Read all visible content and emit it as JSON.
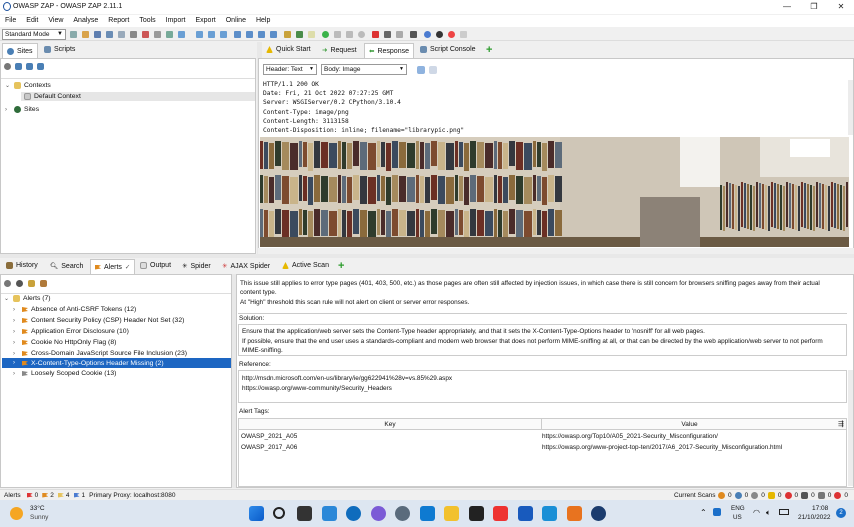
{
  "window": {
    "title": "OWASP ZAP - OWASP ZAP 2.11.1",
    "controls": [
      "—",
      "❐",
      "✕"
    ]
  },
  "menu": [
    "File",
    "Edit",
    "View",
    "Analyse",
    "Report",
    "Tools",
    "Import",
    "Export",
    "Online",
    "Help"
  ],
  "toolbar": {
    "mode": "Standard Mode"
  },
  "left_top": {
    "tabs": [
      "Sites",
      "Scripts"
    ],
    "tree": {
      "contexts": "Contexts",
      "default_context": "Default Context",
      "sites": "Sites"
    }
  },
  "right_top": {
    "tabs": [
      "Quick Start",
      "Request",
      "Response",
      "Script Console"
    ],
    "header_view": "Header: Text",
    "body_view": "Body: Image",
    "response_headers": [
      "HTTP/1.1 200 OK",
      "Date: Fri, 21 Oct 2022 07:27:25 GMT",
      "Server: WSGIServer/0.2 CPython/3.10.4",
      "Content-Type: image/png",
      "Content-Length: 3113158",
      "Content-Disposition: inline; filename=\"librarypic.png\""
    ]
  },
  "bottom": {
    "tabs": [
      "History",
      "Search",
      "Alerts",
      "Output",
      "Spider",
      "AJAX Spider",
      "Active Scan"
    ],
    "alerts_root": "Alerts (7)",
    "alerts": [
      "Absence of Anti-CSRF Tokens (12)",
      "Content Security Policy (CSP) Header Not Set (32)",
      "Application Error Disclosure (10)",
      "Cookie No HttpOnly Flag (8)",
      "Cross-Domain JavaScript Source File Inclusion (23)",
      "X-Content-Type-Options Header Missing (2)",
      "Loosely Scoped Cookie (13)"
    ],
    "selected_index": 5,
    "detail": {
      "description_lines": [
        "This issue still applies to error type pages (401, 403, 500, etc.) as those pages are often still affected by injection issues, in which case there is still concern for browsers sniffing pages away from their actual",
        "content type.",
        "At \"High\" threshold this scan rule will not alert on client or server error responses."
      ],
      "solution_label": "Solution:",
      "solution_lines": [
        "Ensure that the application/web server sets the Content-Type header appropriately, and that it sets the X-Content-Type-Options header to 'nosniff' for all web pages.",
        "If possible, ensure that the end user uses a standards-compliant and modern web browser that does not perform MIME-sniffing at all, or that can be directed by the web application/web server to not perform",
        "MIME-sniffing."
      ],
      "reference_label": "Reference:",
      "reference_lines": [
        "http://msdn.microsoft.com/en-us/library/ie/gg622941%28v=vs.85%29.aspx",
        "https://owasp.org/www-community/Security_Headers"
      ],
      "tags_label": "Alert Tags:",
      "tags_header": {
        "key": "Key",
        "value": "Value"
      },
      "tags": [
        {
          "key": "OWASP_2021_A05",
          "value": "https://owasp.org/Top10/A05_2021-Security_Misconfiguration/"
        },
        {
          "key": "OWASP_2017_A06",
          "value": "https://owasp.org/www-project-top-ten/2017/A6_2017-Security_Misconfiguration.html"
        }
      ]
    }
  },
  "statusbar": {
    "alerts_label": "Alerts",
    "counts": [
      "0",
      "2",
      "4",
      "1"
    ],
    "proxy": "Primary Proxy: localhost:8080",
    "current_scans_label": "Current Scans",
    "scan_counts": [
      "0",
      "0",
      "0",
      "0",
      "0",
      "0",
      "0",
      "0"
    ]
  },
  "taskbar": {
    "weather_temp": "33°C",
    "weather_desc": "Sunny",
    "lang_1": "ENG",
    "lang_2": "US",
    "time": "17:08",
    "date": "21/10/2022",
    "notif_count": "2"
  },
  "colors": {
    "selected_row": "#1d66c2",
    "accent_orange": "#e08a1e",
    "taskbar_bg": "#dde6f1"
  }
}
